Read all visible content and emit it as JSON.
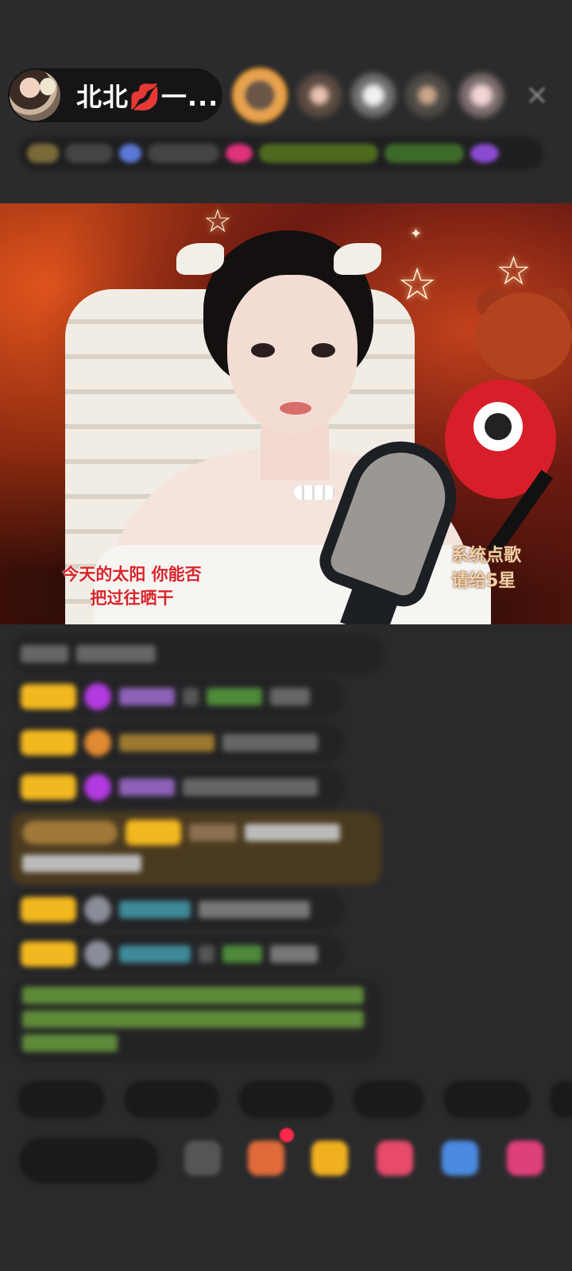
{
  "header": {
    "host_name": "北北💋一..."
  },
  "video": {
    "lyrics_line1": "今天的太阳 你能否",
    "lyrics_line2": "把过往晒干",
    "song_request_line1": "系统点歌",
    "song_request_line2": "请给5星"
  },
  "colors": {
    "background": "#2a2a2c",
    "lyrics_red": "#d8242a",
    "badge_gold": "#f2b81f",
    "gem_purple": "#b23ae0"
  },
  "icons": {
    "close": "×"
  }
}
